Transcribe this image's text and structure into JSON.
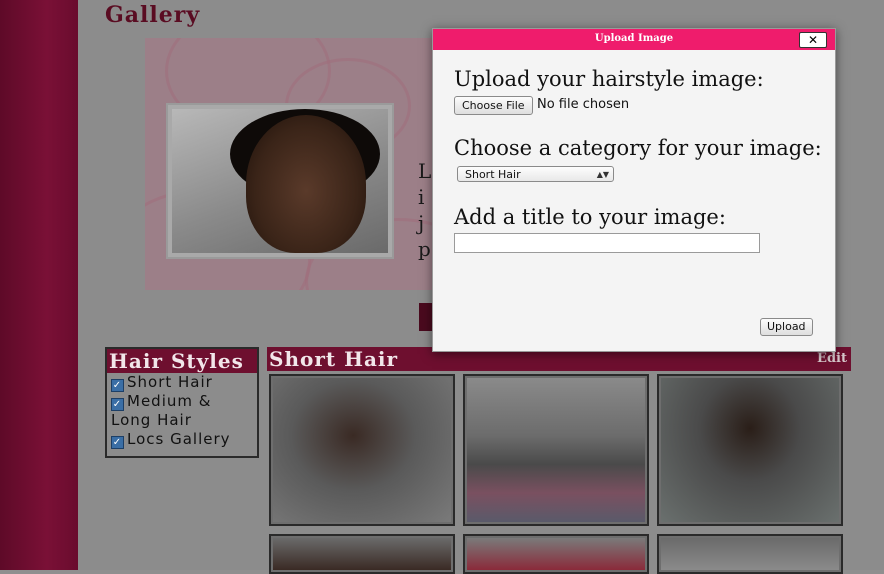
{
  "page": {
    "gallery_title": "Gallery",
    "intro_text_fragment": "L\ni\nj\np"
  },
  "sidebar": {
    "title": "Hair Styles",
    "items": [
      {
        "label": "Short Hair",
        "checked": true
      },
      {
        "label": "Medium & Long Hair",
        "checked": true
      },
      {
        "label": "Locs Gallery",
        "checked": true
      }
    ]
  },
  "section": {
    "title": "Short Hair",
    "edit_label": "Edit"
  },
  "modal": {
    "title": "Upload Image",
    "close_label": "✕",
    "upload_prompt": "Upload your hairstyle image:",
    "choose_file_label": "Choose File",
    "file_status": "No file chosen",
    "category_prompt": "Choose a category for your image:",
    "category_selected": "Short Hair",
    "title_prompt": "Add a title to your image:",
    "title_value": "",
    "upload_button": "Upload"
  },
  "colors": {
    "modal_bar": "#ef1c6c",
    "header_maroon": "#6e0f2f",
    "overlay_gray": "#8c8c8c"
  }
}
